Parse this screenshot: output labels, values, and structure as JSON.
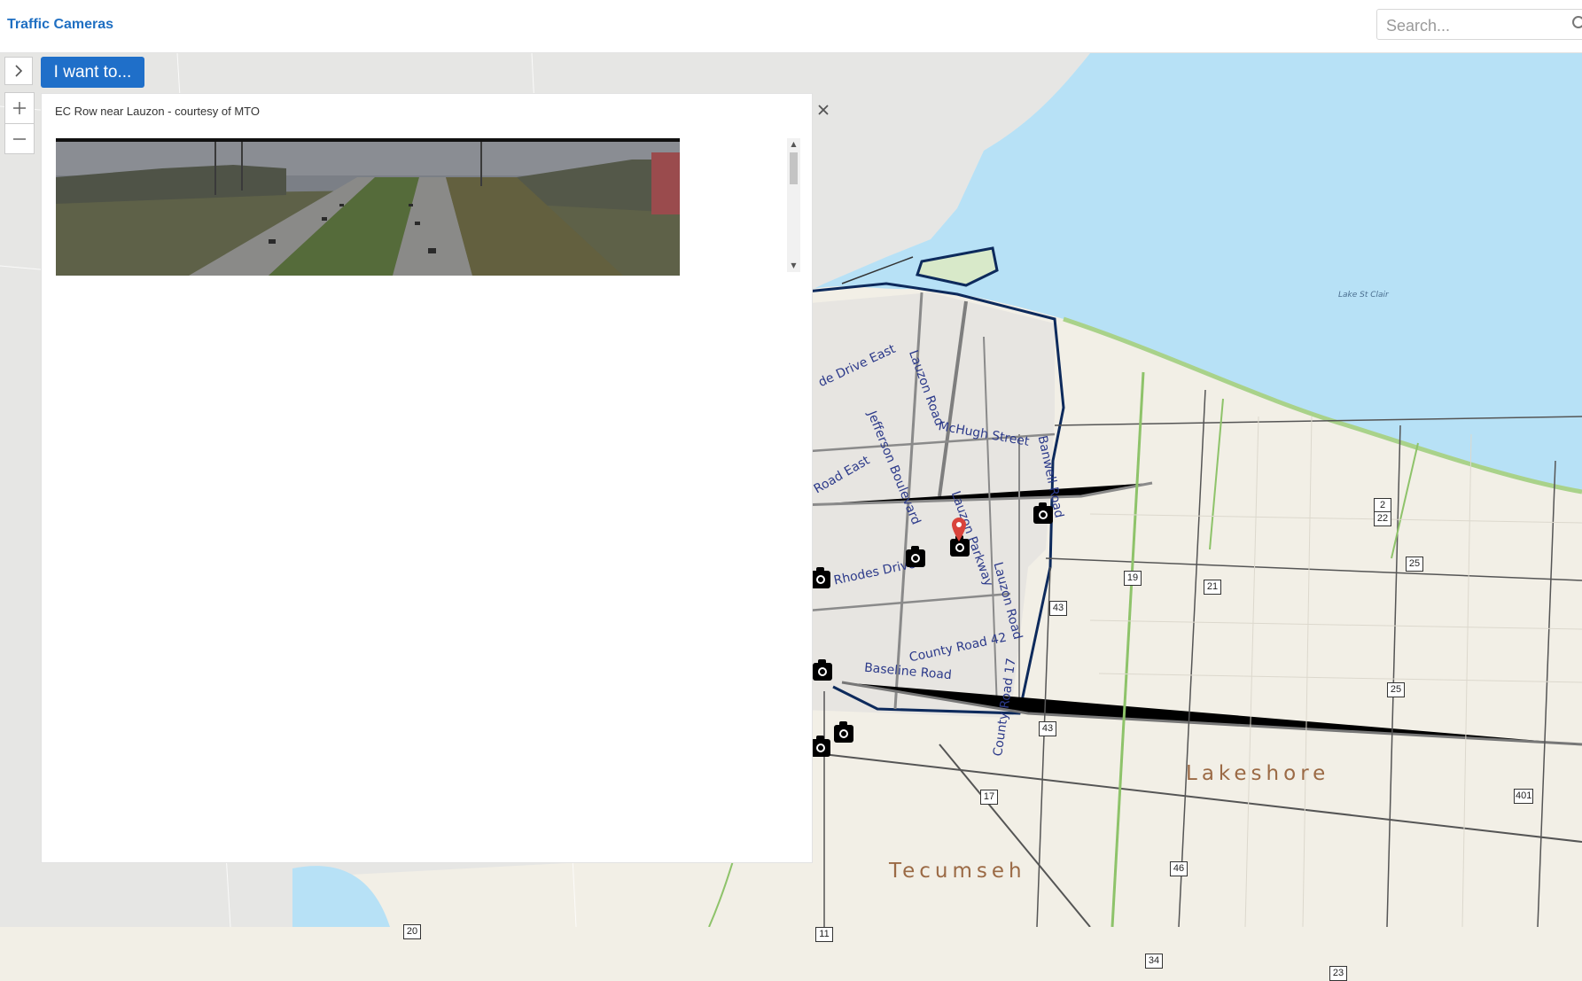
{
  "header": {
    "title": "Traffic Cameras",
    "search_placeholder": "Search..."
  },
  "toolbar": {
    "i_want_to_label": "I want to...",
    "nav_toggle_icon": "chevron-right-icon",
    "zoom_in_icon": "plus-icon",
    "zoom_out_icon": "minus-icon"
  },
  "popup": {
    "title": "EC Row near Lauzon - courtesy of MTO",
    "close_icon": "close-icon",
    "image": "traffic camera feed of highway"
  },
  "map": {
    "lake_label": "Lake St Clair",
    "municipalities": [
      "Lakeshore",
      "Tecumseh"
    ],
    "road_labels": [
      "de Drive East",
      "Lauzon Road",
      "McHugh Street",
      "Jefferson Boulevard",
      "Road East",
      "Banwell Road",
      "Lauzon Parkway",
      "Rhodes Drive",
      "Lauzon Road",
      "County Road 42",
      "Baseline Road",
      "County Road 17"
    ],
    "shields": [
      "2",
      "22",
      "25",
      "19",
      "21",
      "43",
      "25",
      "43",
      "17",
      "401",
      "46",
      "20",
      "11",
      "34",
      "23"
    ],
    "colors": {
      "water": "#b7e1f6",
      "land": "#f2efe6",
      "urban": "#e8e6e2",
      "boundary": "#0d2a5c",
      "accent": "#1f6fc9",
      "marker": "#d9433b"
    }
  }
}
